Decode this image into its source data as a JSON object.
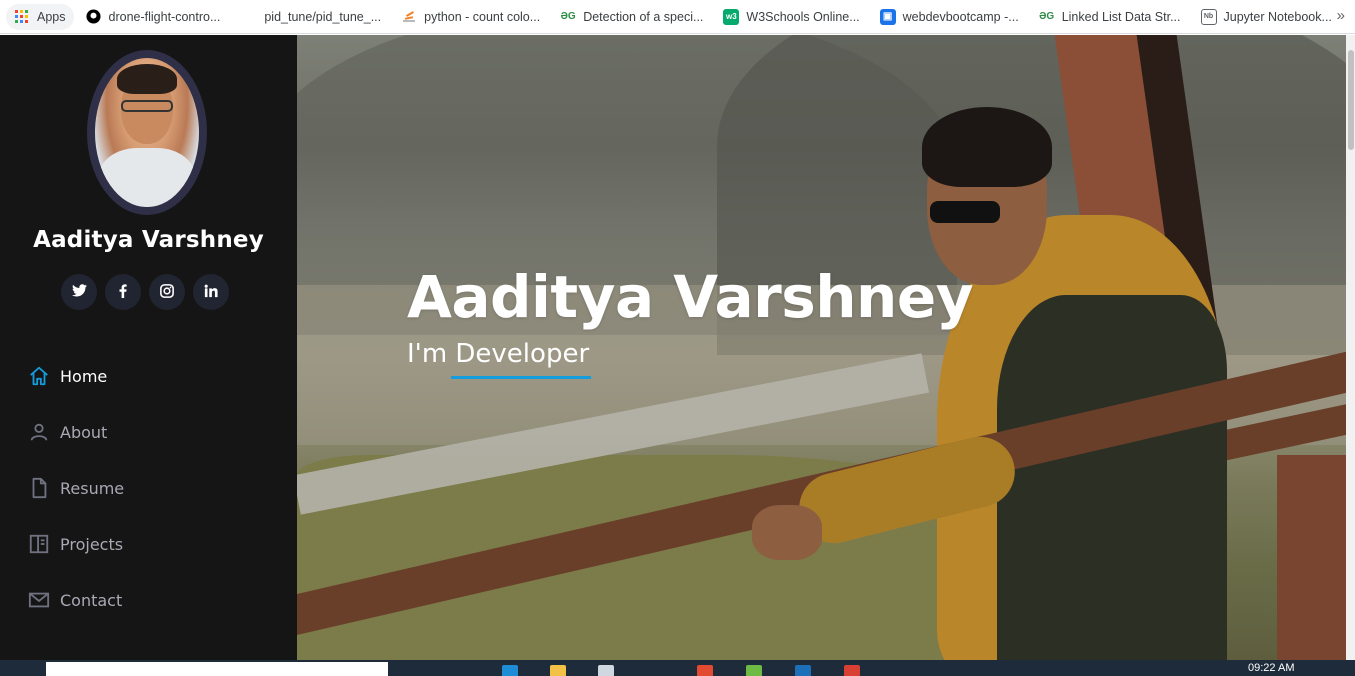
{
  "bookmarks": [
    {
      "label": "Apps",
      "icon": "apps-grid-icon",
      "color": "#ea4335"
    },
    {
      "label": "drone-flight-contro...",
      "icon": "github-icon",
      "color": "#000000"
    },
    {
      "label": "pid_tune/pid_tune_...",
      "icon": "",
      "color": ""
    },
    {
      "label": "python - count colo...",
      "icon": "stackoverflow-icon",
      "color": "#f48024"
    },
    {
      "label": "Detection of a speci...",
      "icon": "geeksforgeeks-icon",
      "color": "#2f8d46"
    },
    {
      "label": "W3Schools Online...",
      "icon": "w3schools-icon",
      "color": "#04aa6d"
    },
    {
      "label": "webdevbootcamp -...",
      "icon": "browser-icon",
      "color": "#1a73e8"
    },
    {
      "label": "Linked List Data Str...",
      "icon": "geeksforgeeks-icon",
      "color": "#2f8d46"
    },
    {
      "label": "Jupyter Notebook...",
      "icon": "notebook-icon",
      "color": "#5f6368"
    }
  ],
  "bookmarks_more": "»",
  "sidebar": {
    "name": "Aaditya Varshney",
    "socials": [
      {
        "name": "twitter",
        "glyph": "t"
      },
      {
        "name": "facebook",
        "glyph": "f"
      },
      {
        "name": "instagram",
        "glyph": "◎"
      },
      {
        "name": "linkedin",
        "glyph": "in"
      }
    ],
    "nav": [
      {
        "label": "Home",
        "icon": "home-icon",
        "active": true
      },
      {
        "label": "About",
        "icon": "user-icon",
        "active": false
      },
      {
        "label": "Resume",
        "icon": "file-icon",
        "active": false
      },
      {
        "label": "Projects",
        "icon": "book-icon",
        "active": false
      },
      {
        "label": "Contact",
        "icon": "envelope-icon",
        "active": false
      }
    ]
  },
  "hero": {
    "title": "Aaditya Varshney",
    "subtitle": "I'm Developer"
  },
  "accent_color": "#149ddd",
  "taskbar": {
    "clock": "09:22 AM"
  }
}
